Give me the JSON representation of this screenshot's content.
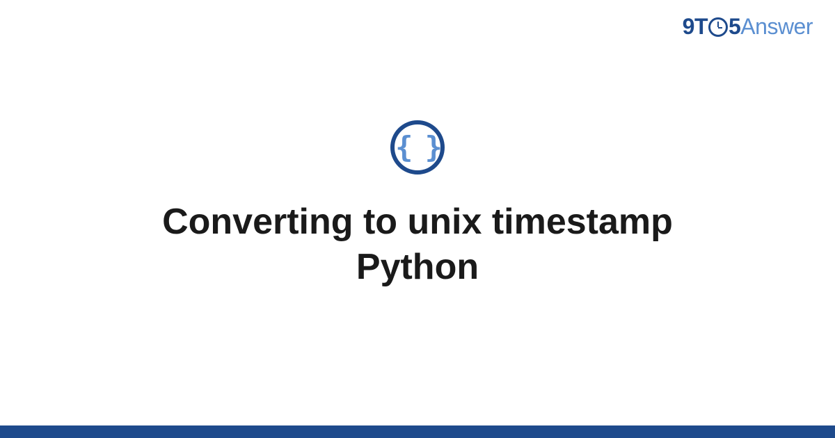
{
  "logo": {
    "part1": "9T",
    "part2": "5",
    "part3": "Answer"
  },
  "badge": {
    "icon_name": "code-braces-icon",
    "symbol": "{ }"
  },
  "title": "Converting to unix timestamp Python",
  "colors": {
    "primary_dark": "#1e4a8c",
    "primary_light": "#5b8fd1",
    "text": "#1a1a1a"
  }
}
